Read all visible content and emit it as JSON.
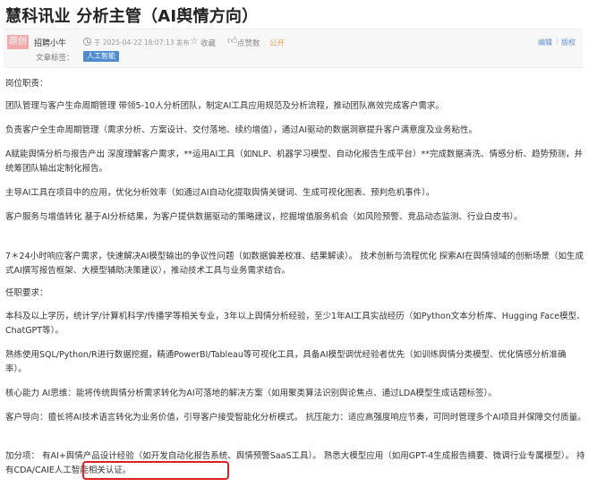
{
  "page_title": "慧科讯业 分析主管（AI舆情方向）",
  "meta": {
    "badge": "原创",
    "author": "招聘小牛",
    "timestamp": "于 2025-04-22 18:07:13 发布",
    "favorite_label": "收藏",
    "like_label": "点赞数",
    "public_label": "公开",
    "edit_link": "编辑",
    "separator": "|",
    "version_link": "版权",
    "tags_label": "文章标签：",
    "tags": [
      "人工智能"
    ]
  },
  "content": {
    "paragraphs": [
      "岗位职责：",
      "团队管理与客户生命周期管理 带领5-10人分析团队，制定AI工具应用规范及分析流程，推动团队高效完成客户需求。",
      "负责客户全生命周期管理（需求分析、方案设计、交付落地、续约增值），通过AI驱动的数据洞察提升客户满意度及业务粘性。",
      "A赋能舆情分析与报告产出 深度理解客户需求，**运用AI工具（如NLP、机器学习模型、自动化报告生成平台）**完成数据清洗、情感分析、趋势预测，并统筹团队输出定制化报告。",
      "主导AI工具在项目中的应用，优化分析效率（如通过AI自动化提取舆情关键词、生成可视化图表、预判危机事件）。",
      "客户服务与增值转化 基于AI分析结果，为客户提供数据驱动的策略建议，挖掘增值服务机会（如风险预警、竞品动态监测、行业白皮书）。",
      "7＊24小时响应客户需求，快速解决AI模型输出的争议性问题（如数据偏差校准、结果解读）。 技术创新与流程优化 探索AI在舆情领域的创新场景（如生成式AI撰写报告框架、大模型辅助决策建议），推动技术工具与业务需求结合。",
      "任职要求：",
      "本科及以上学历，统计学/计算机科学/传播学等相关专业，3年以上舆情分析经验，至少1年AI工具实战经历（如Python文本分析库、Hugging Face模型、ChatGPT等）。",
      "熟练使用SQL/Python/R进行数据挖掘，精通PowerBI/Tableau等可视化工具，具备AI模型调优经验者优先（如训练舆情分类模型、优化情感分析准确率）。",
      "核心能力 AI思维：能将传统舆情分析需求转化为AI可落地的解决方案（如用聚类算法识别舆论焦点、通过LDA模型生成话题标签）。",
      "客户导向：擅长将AI技术语言转化为业务价值，引导客户接受智能化分析模式。 抗压能力：适应高强度响应节奏，可同时管理多个AI项目并保障交付质量。",
      "加分项： 有AI+舆情产品设计经验（如开发自动化报告系统、舆情预警SaaS工具）。 熟悉大模型应用（如用GPT-4生成报告摘要、微调行业专属模型）。 持有CDA/CAIE人工智能相关认证。"
    ]
  },
  "highlight_color": "#e02020",
  "tag_color": "#4f8bd0",
  "accent_color": "#e7a14a"
}
